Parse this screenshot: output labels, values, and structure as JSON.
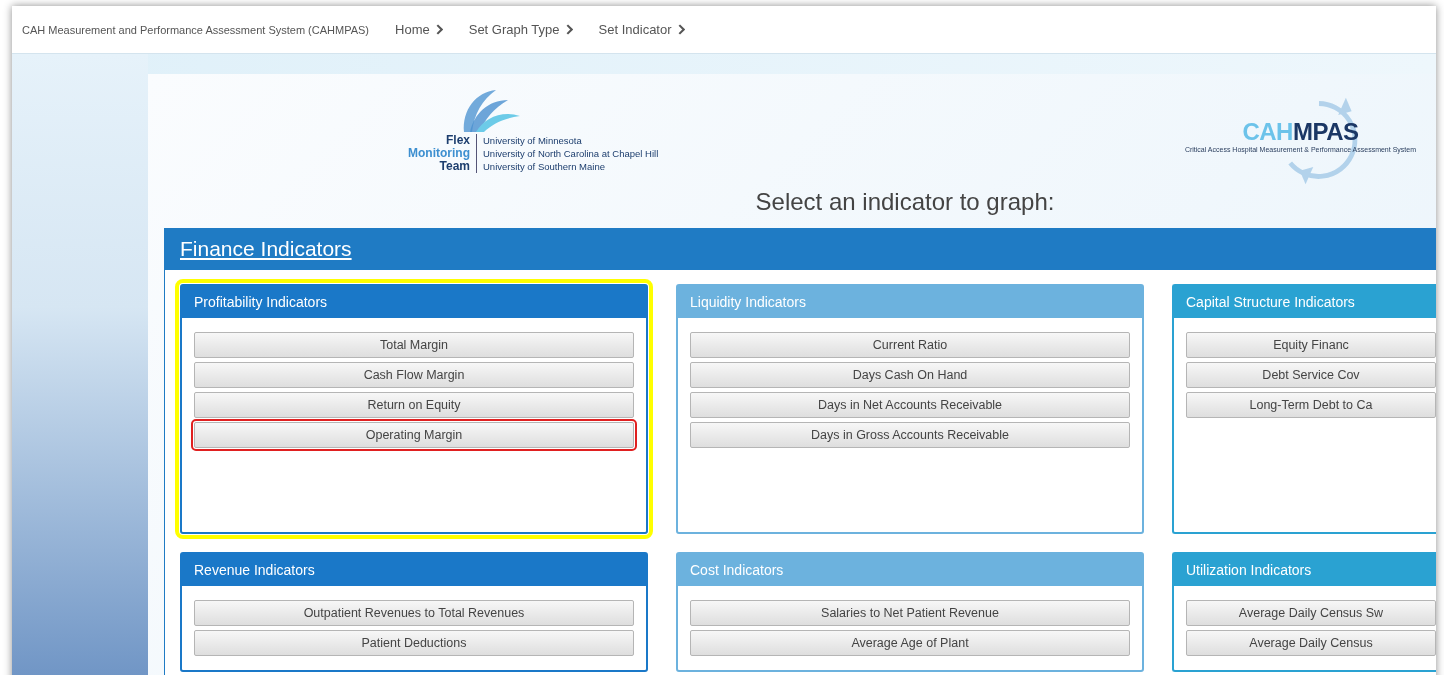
{
  "nav": {
    "app_title": "CAH Measurement and Performance Assessment System (CAHMPAS)",
    "crumbs": [
      "Home",
      "Set Graph Type",
      "Set Indicator"
    ]
  },
  "logos": {
    "flex": {
      "lines": [
        "Flex",
        "Monitoring",
        "Team"
      ],
      "universities": [
        "University of Minnesota",
        "University of North Carolina at Chapel Hill",
        "University of Southern Maine"
      ]
    },
    "cahmpas": {
      "title": "CAH**MPAS**",
      "subtitle": "Critical Access Hospital Measurement & Performance Assessment System"
    }
  },
  "heading": "Select an indicator to graph:",
  "section": {
    "title": "Finance Indicators",
    "groups": [
      {
        "title": "Profitability Indicators",
        "color": "#1a78c8",
        "highlighted": true,
        "indicators": [
          {
            "label": "Total Margin",
            "highlighted": false
          },
          {
            "label": "Cash Flow Margin",
            "highlighted": false
          },
          {
            "label": "Return on Equity",
            "highlighted": false
          },
          {
            "label": "Operating Margin",
            "highlighted": true
          }
        ]
      },
      {
        "title": "Liquidity Indicators",
        "color": "#6cb2de",
        "highlighted": false,
        "indicators": [
          {
            "label": "Current Ratio",
            "highlighted": false
          },
          {
            "label": "Days Cash On Hand",
            "highlighted": false
          },
          {
            "label": "Days in Net Accounts Receivable",
            "highlighted": false
          },
          {
            "label": "Days in Gross Accounts Receivable",
            "highlighted": false
          }
        ]
      },
      {
        "title": "Capital Structure Indicators",
        "color": "#2aa2d2",
        "highlighted": false,
        "indicators": [
          {
            "label": "Equity Financ",
            "highlighted": false
          },
          {
            "label": "Debt Service Cov",
            "highlighted": false
          },
          {
            "label": "Long-Term Debt to Ca",
            "highlighted": false
          }
        ]
      },
      {
        "title": "Revenue Indicators",
        "color": "#1a78c8",
        "highlighted": false,
        "indicators": [
          {
            "label": "Outpatient Revenues to Total Revenues",
            "highlighted": false
          },
          {
            "label": "Patient Deductions",
            "highlighted": false
          }
        ]
      },
      {
        "title": "Cost Indicators",
        "color": "#6cb2de",
        "highlighted": false,
        "indicators": [
          {
            "label": "Salaries to Net Patient Revenue",
            "highlighted": false
          },
          {
            "label": "Average Age of Plant",
            "highlighted": false
          }
        ]
      },
      {
        "title": "Utilization Indicators",
        "color": "#2aa2d2",
        "highlighted": false,
        "indicators": [
          {
            "label": "Average Daily Census Sw",
            "highlighted": false
          },
          {
            "label": "Average Daily Census",
            "highlighted": false
          }
        ]
      }
    ]
  }
}
